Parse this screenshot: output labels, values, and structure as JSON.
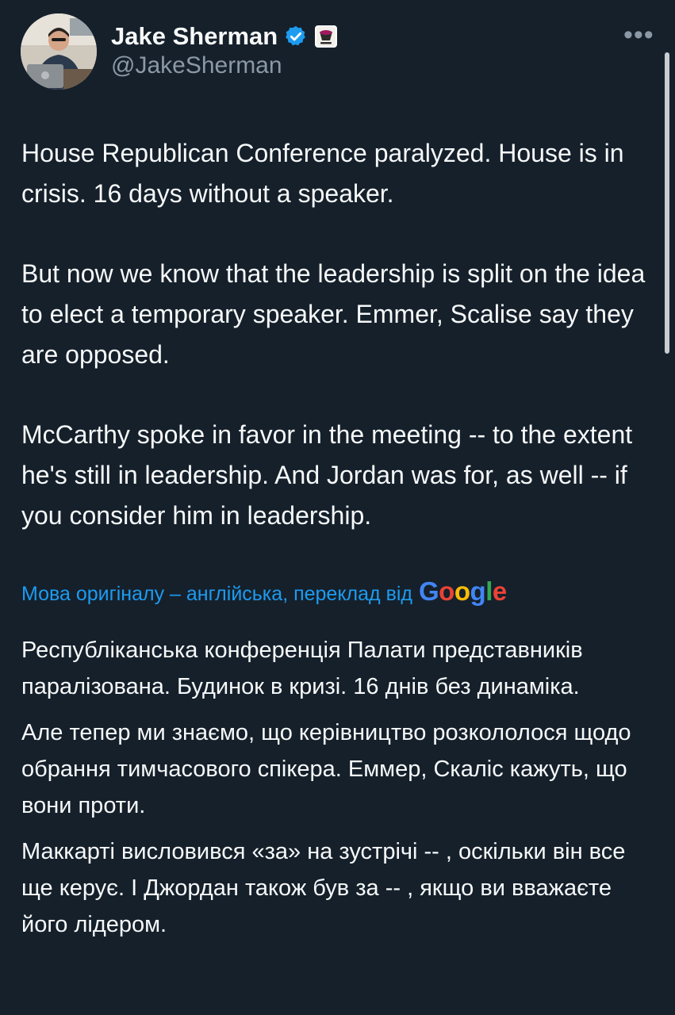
{
  "tweet": {
    "author": {
      "name": "Jake Sherman",
      "handle": "@JakeSherman",
      "avatar_icon": "profile-photo",
      "verified": true,
      "verified_color": "#1d9bf0"
    },
    "more_label": "•••",
    "paragraphs": [
      "House Republican Conference paralyzed. House is in crisis. 16 days without a speaker.",
      "But now we know that the leadership is split on the idea to elect a temporary speaker. Emmer, Scalise say they are opposed.",
      "McCarthy spoke in favor in the meeting -- to the extent he's still in leadership. And Jordan was for, as well -- if you consider him in leadership."
    ]
  },
  "translation": {
    "note": "Мова оригіналу – англійська, переклад від",
    "provider": "Google",
    "link_color": "#1d9bf0",
    "paragraphs": [
      "Республіканська конференція Палати представників паралізована. Будинок в кризі. 16 днів без динаміка.",
      "Але тепер ми знаємо, що керівництво розкололося щодо обрання тимчасового спікера. Еммер, Скаліс кажуть, що вони проти.",
      "Маккарті висловився «за» на зустрічі -- , оскільки він все ще керує. І Джордан також був за -- , якщо ви вважаєте його лідером."
    ]
  }
}
